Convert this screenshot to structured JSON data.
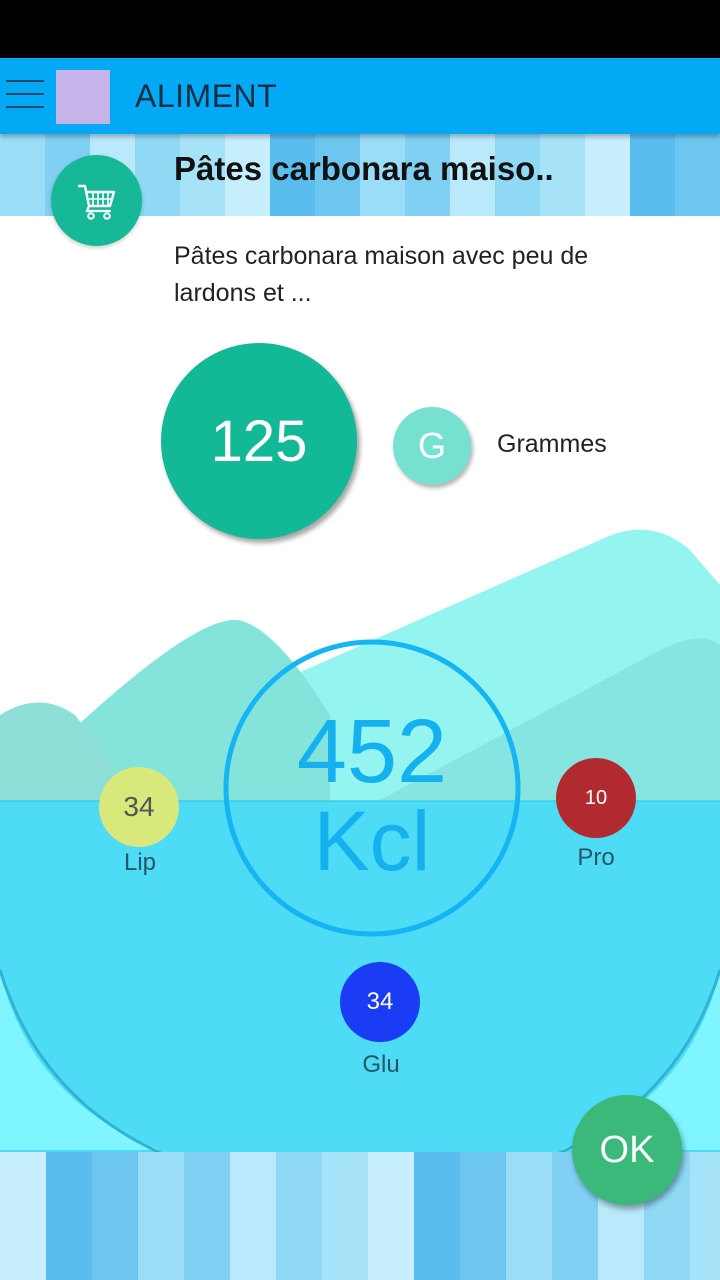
{
  "app_bar": {
    "title": "ALIMENT",
    "avatar_color": "#c5b3ea",
    "background": "#03a9f4"
  },
  "food": {
    "title": "Pâtes carbonara maiso..",
    "description": "Pâtes carbonara maison avec peu de lardons et ..."
  },
  "portion": {
    "quantity": "125",
    "unit_symbol": "G",
    "unit_label": "Grammes"
  },
  "energy": {
    "value": "452",
    "unit": "Kcl"
  },
  "macros": {
    "lip": {
      "value": "34",
      "label": "Lip",
      "color": "#d9e87a"
    },
    "pro": {
      "value": "10",
      "label": "Pro",
      "color": "#b02a30"
    },
    "glu": {
      "value": "34",
      "label": "Glu",
      "color": "#1a3cf5"
    }
  },
  "actions": {
    "ok_label": "OK",
    "cart_icon": "shopping-cart-icon",
    "menu_icon": "hamburger-menu-icon"
  }
}
